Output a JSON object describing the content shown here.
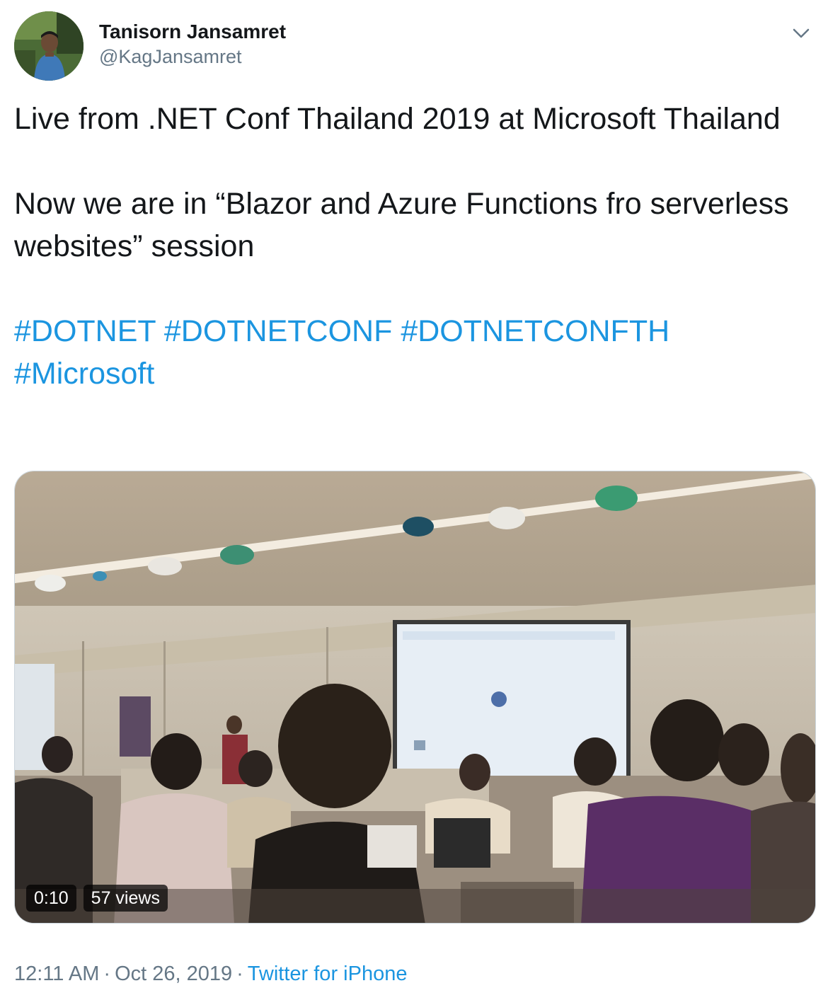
{
  "author": {
    "display_name": "Tanisorn Jansamret",
    "handle": "@KagJansamret",
    "avatar_icon": "profile-photo"
  },
  "tweet": {
    "text_para1": "Live from .NET Conf Thailand 2019 at Microsoft Thailand",
    "text_para2": "Now we are in “Blazor and Azure Functions fro serverless websites” session",
    "hashtags": [
      "#DOTNET",
      "#DOTNETCONF",
      "#DOTNETCONFTH",
      "#Microsoft"
    ]
  },
  "video": {
    "duration": "0:10",
    "views": "57 views"
  },
  "meta": {
    "time": "12:11 AM",
    "date": "Oct 26, 2019",
    "separator": "·",
    "source": "Twitter for iPhone"
  },
  "colors": {
    "link": "#1b95e0",
    "secondary_text": "#657786",
    "primary_text": "#14171a"
  },
  "icons": {
    "caret": "chevron-down-icon"
  }
}
